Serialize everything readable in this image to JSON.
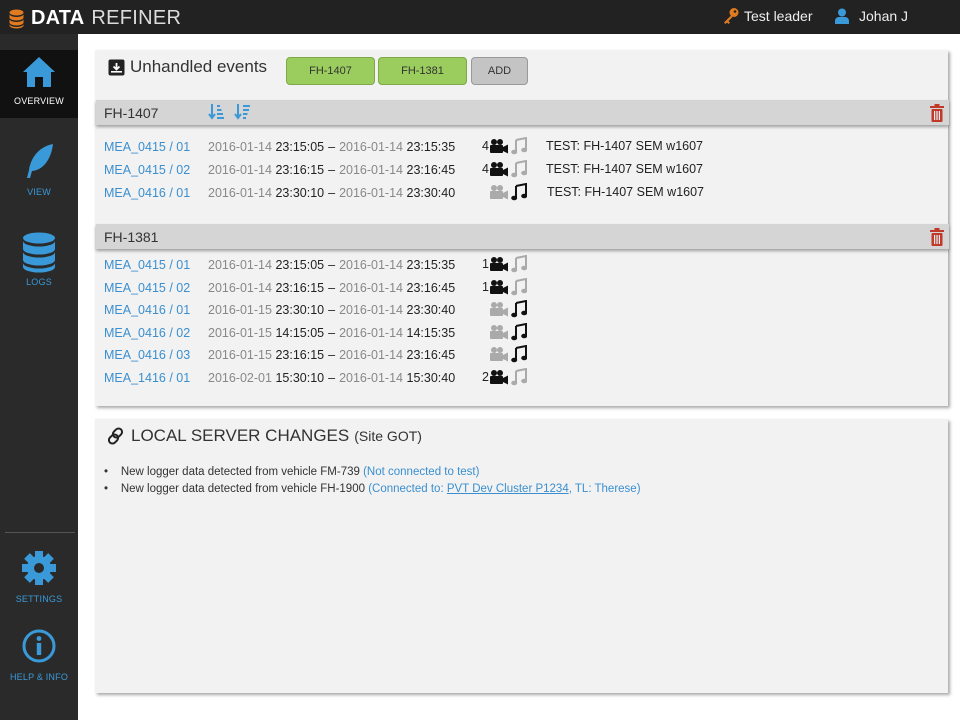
{
  "app": {
    "title_bold": "DATA",
    "title_light": "REFINER"
  },
  "header": {
    "role_label": "Test leader",
    "user_name": "Johan J"
  },
  "sidebar": {
    "items": [
      {
        "label": "OVERVIEW",
        "icon": "home-icon"
      },
      {
        "label": "VIEW",
        "icon": "feather-icon"
      },
      {
        "label": "LOGS",
        "icon": "database-icon"
      },
      {
        "label": "SETTINGS",
        "icon": "gear-icon"
      },
      {
        "label": "HELP & INFO",
        "icon": "info-icon"
      }
    ]
  },
  "unhandled": {
    "title": "Unhandled events",
    "buttons": [
      "FH-1407",
      "FH-1381",
      "ADD"
    ],
    "groups": [
      {
        "name": "FH-1407",
        "rows": [
          {
            "mea": "MEA_0415 / 01",
            "d1": "2016-01-14",
            "t1": "23:15:05",
            "d2": "2016-01-14",
            "t2": "23:15:35",
            "count": "4",
            "test": "TEST: FH-1407 SEM w1607"
          },
          {
            "mea": "MEA_0415 / 02",
            "d1": "2016-01-14",
            "t1": "23:16:15",
            "d2": "2016-01-14",
            "t2": "23:16:45",
            "count": "4",
            "test": "TEST: FH-1407 SEM w1607"
          },
          {
            "mea": "MEA_0416 / 01",
            "d1": "2016-01-14",
            "t1": "23:30:10",
            "d2": "2016-01-14",
            "t2": "23:30:40",
            "count": "",
            "test": "TEST: FH-1407 SEM w1607"
          }
        ]
      },
      {
        "name": "FH-1381",
        "rows": [
          {
            "mea": "MEA_0415 / 01",
            "d1": "2016-01-14",
            "t1": "23:15:05",
            "d2": "2016-01-14",
            "t2": "23:15:35",
            "count": "1"
          },
          {
            "mea": "MEA_0415 / 02",
            "d1": "2016-01-14",
            "t1": "23:16:15",
            "d2": "2016-01-14",
            "t2": "23:16:45",
            "count": "1"
          },
          {
            "mea": "MEA_0416 / 01",
            "d1": "2016-01-15",
            "t1": "23:30:10",
            "d2": "2016-01-14",
            "t2": "23:30:40",
            "count": ""
          },
          {
            "mea": "MEA_0416 / 02",
            "d1": "2016-01-15",
            "t1": "14:15:05",
            "d2": "2016-01-14",
            "t2": "14:15:35",
            "count": ""
          },
          {
            "mea": "MEA_0416 / 03",
            "d1": "2016-01-15",
            "t1": "23:16:15",
            "d2": "2016-01-14",
            "t2": "23:16:45",
            "count": ""
          },
          {
            "mea": "MEA_1416 / 01",
            "d1": "2016-02-01",
            "t1": "15:30:10",
            "d2": "2016-01-14",
            "t2": "15:30:40",
            "count": "2"
          }
        ]
      }
    ]
  },
  "local": {
    "title": "LOCAL SERVER CHANGES",
    "site": "(Site GOT)",
    "items": [
      {
        "text": "New logger data detected from vehicle FM-739",
        "note": "(Not connected to test)"
      },
      {
        "text": "New logger data detected from vehicle FH-1900",
        "note_prefix": "(Connected to:",
        "link": "PVT Dev Cluster P1234",
        "note_suffix": ", TL: Therese)"
      }
    ]
  },
  "colors": {
    "accent": "#3a9ad9",
    "green_button": "#9acd5d",
    "trash": "#c0392b",
    "topbar": "#222222"
  }
}
